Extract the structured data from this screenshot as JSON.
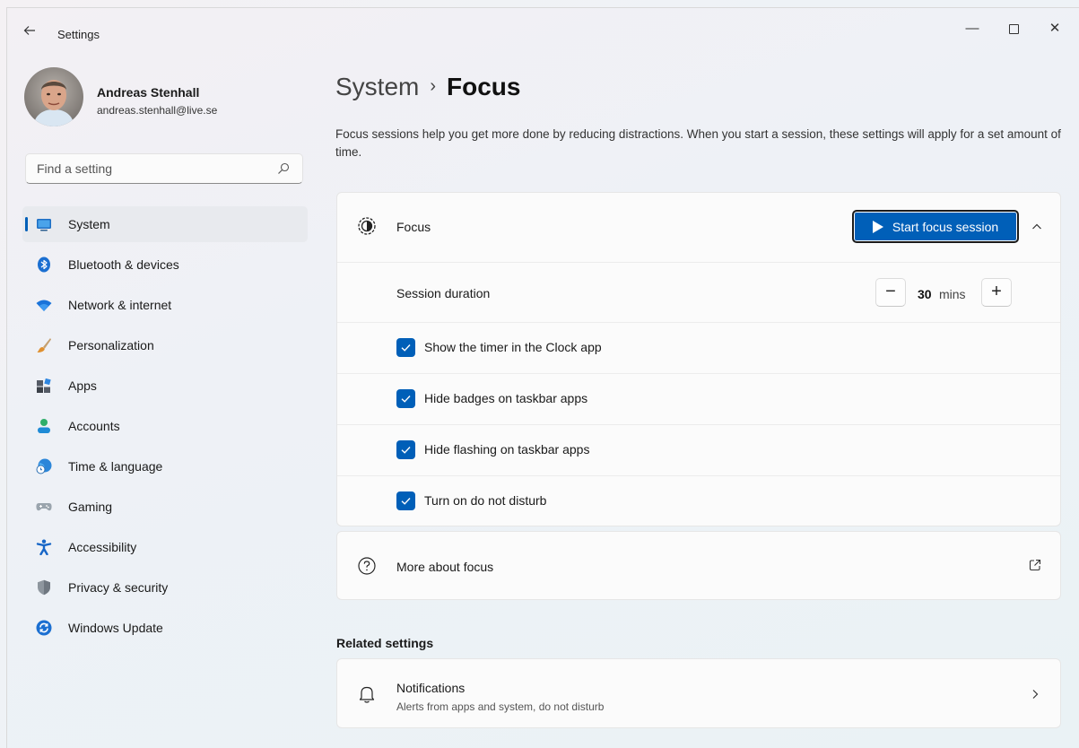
{
  "window": {
    "title": "Settings",
    "back_icon": "arrow-left-icon",
    "minimize_glyph": "—",
    "close_glyph": "✕"
  },
  "profile": {
    "name": "Andreas Stenhall",
    "email": "andreas.stenhall@live.se"
  },
  "search": {
    "placeholder": "Find a setting",
    "icon": "search-icon"
  },
  "nav": {
    "items": [
      {
        "label": "System",
        "icon": "system-display-icon",
        "active": true
      },
      {
        "label": "Bluetooth & devices",
        "icon": "bluetooth-icon"
      },
      {
        "label": "Network & internet",
        "icon": "wifi-icon"
      },
      {
        "label": "Personalization",
        "icon": "brush-icon"
      },
      {
        "label": "Apps",
        "icon": "apps-icon"
      },
      {
        "label": "Accounts",
        "icon": "accounts-icon"
      },
      {
        "label": "Time & language",
        "icon": "time-language-icon"
      },
      {
        "label": "Gaming",
        "icon": "gamepad-icon"
      },
      {
        "label": "Accessibility",
        "icon": "accessibility-icon"
      },
      {
        "label": "Privacy & security",
        "icon": "shield-icon"
      },
      {
        "label": "Windows Update",
        "icon": "windows-update-icon"
      }
    ]
  },
  "main": {
    "breadcrumb": {
      "parent": "System",
      "separator": "›",
      "current": "Focus"
    },
    "description": "Focus sessions help you get more done by reducing distractions. When you start a session, these settings will apply for a set amount of time.",
    "focus": {
      "label": "Focus",
      "start_button": "Start focus session",
      "session_duration_label": "Session duration",
      "duration_value": "30",
      "duration_unit": "mins",
      "minus_glyph": "−",
      "plus_glyph": "+",
      "options": [
        {
          "label": "Show the timer in the Clock app",
          "checked": true
        },
        {
          "label": "Hide badges on taskbar apps",
          "checked": true
        },
        {
          "label": "Hide flashing on taskbar apps",
          "checked": true
        },
        {
          "label": "Turn on do not disturb",
          "checked": true
        }
      ]
    },
    "more_about": {
      "label": "More about focus"
    },
    "related_title": "Related settings",
    "notifications": {
      "title": "Notifications",
      "subtitle": "Alerts from apps and system, do not disturb"
    }
  },
  "colors": {
    "accent": "#005fb8",
    "card": "#fbfbfb",
    "nav_active": "#e8eaee"
  }
}
